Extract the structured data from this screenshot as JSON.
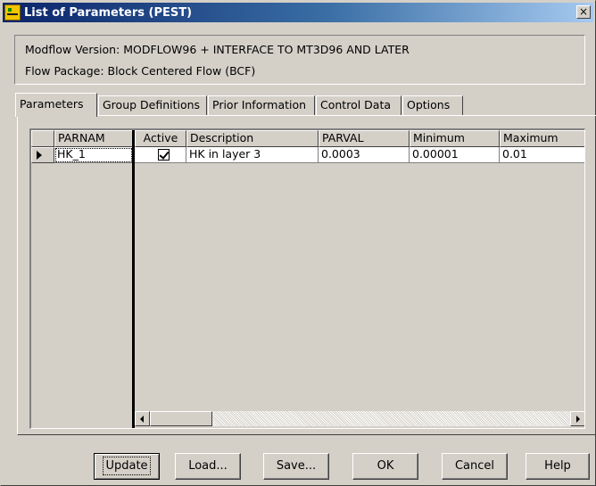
{
  "window": {
    "title": "List of Parameters (PEST)",
    "close_glyph": "×",
    "app_icon": "pest-app-icon"
  },
  "info": {
    "modflow_version": "Modflow Version: MODFLOW96 + INTERFACE TO MT3D96 AND LATER",
    "flow_package": "Flow Package: Block Centered Flow (BCF)"
  },
  "tabs": [
    {
      "label": "Parameters",
      "active": true
    },
    {
      "label": "Group Definitions",
      "active": false
    },
    {
      "label": "Prior Information",
      "active": false
    },
    {
      "label": "Control Data",
      "active": false
    },
    {
      "label": "Options",
      "active": false
    }
  ],
  "grid": {
    "columns": [
      "PARNAM",
      "Active",
      "Description",
      "PARVAL",
      "Minimum",
      "Maximum"
    ],
    "rows": [
      {
        "parnam": "HK_1",
        "active": true,
        "description": "HK in layer 3",
        "parval": "0.0003",
        "minimum": "0.00001",
        "maximum": "0.01"
      }
    ]
  },
  "buttons": {
    "update": "Update",
    "load": "Load...",
    "save": "Save...",
    "ok": "OK",
    "cancel": "Cancel",
    "help": "Help"
  },
  "colors": {
    "face": "#d4d0c8",
    "title_start": "#0a246a",
    "title_end": "#a6caf0"
  }
}
